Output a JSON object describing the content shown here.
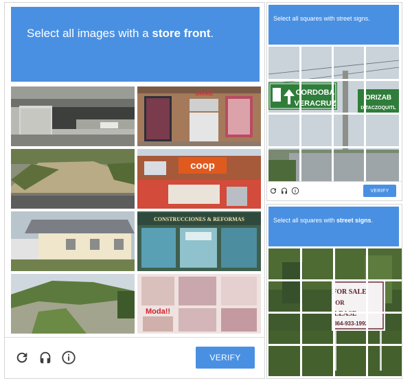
{
  "left_widget": {
    "instruction_prefix": "Select all images with a ",
    "instruction_target": "store front",
    "instruction_suffix": ".",
    "tile_signs": {
      "game": "GAME",
      "coop": "coop",
      "construcciones": "CONSTRUCCIONES & REFORMAS",
      "moda": "Moda!!"
    },
    "verify_label": "VERIFY",
    "icons": [
      "reload-icon",
      "audio-icon",
      "info-icon"
    ]
  },
  "top_right_widget": {
    "instruction": "Select all squares with street signs.",
    "sign_left_top": "CORDOBA",
    "sign_left_bottom": "VERACRUZ",
    "sign_right_top": "ORIZAB",
    "sign_right_bottom": "IXTACZOQUITL",
    "verify_label": "VERIFY"
  },
  "bottom_right_widget": {
    "instruction_prefix": "Select all squares with ",
    "instruction_target": "street signs",
    "instruction_suffix": ".",
    "sign_line1": "FOR SALE",
    "sign_line2": "OR",
    "sign_line3": "LEASE",
    "sign_phone": "864-933-1992"
  },
  "colors": {
    "header_blue": "#4a90e2",
    "button_blue": "#4a90e2",
    "sign_green": "#2e7d32"
  }
}
